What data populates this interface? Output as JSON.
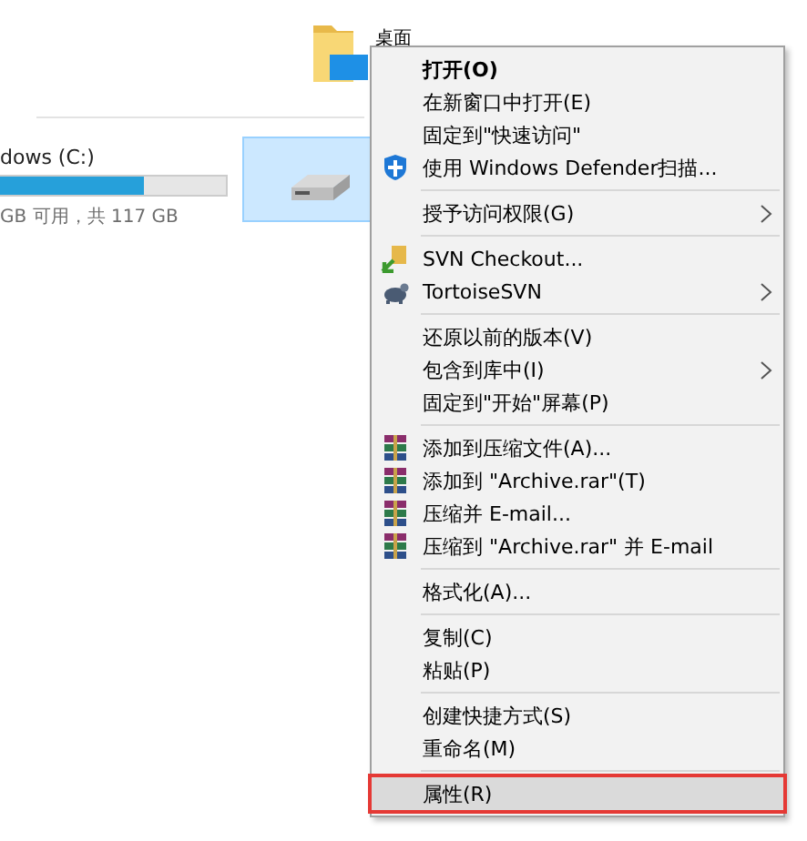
{
  "folder": {
    "label": "桌面"
  },
  "drive": {
    "name": "dows (C:)",
    "level": 0.64,
    "space": "GB 可用，共 117 GB",
    "selected": true
  },
  "menu": {
    "groups": [
      [
        {
          "label": "打开(O)",
          "kind": "plain",
          "default": true,
          "submenu": false,
          "selected": false,
          "callout": false
        },
        {
          "label": "在新窗口中打开(E)",
          "kind": "plain",
          "default": false,
          "submenu": false,
          "selected": false,
          "callout": false
        },
        {
          "label": "固定到\"快速访问\"",
          "kind": "plain",
          "default": false,
          "submenu": false,
          "selected": false,
          "callout": false
        },
        {
          "label": "使用 Windows Defender扫描...",
          "kind": "shield",
          "default": false,
          "submenu": false,
          "selected": false,
          "callout": false
        }
      ],
      [
        {
          "label": "授予访问权限(G)",
          "kind": "plain",
          "default": false,
          "submenu": true,
          "selected": false,
          "callout": false
        }
      ],
      [
        {
          "label": "SVN Checkout...",
          "kind": "checkout",
          "default": false,
          "submenu": false,
          "selected": false,
          "callout": false
        },
        {
          "label": "TortoiseSVN",
          "kind": "tortoise",
          "default": false,
          "submenu": true,
          "selected": false,
          "callout": false
        }
      ],
      [
        {
          "label": "还原以前的版本(V)",
          "kind": "plain",
          "default": false,
          "submenu": false,
          "selected": false,
          "callout": false
        },
        {
          "label": "包含到库中(I)",
          "kind": "plain",
          "default": false,
          "submenu": true,
          "selected": false,
          "callout": false
        },
        {
          "label": "固定到\"开始\"屏幕(P)",
          "kind": "plain",
          "default": false,
          "submenu": false,
          "selected": false,
          "callout": false
        }
      ],
      [
        {
          "label": "添加到压缩文件(A)...",
          "kind": "archive",
          "default": false,
          "submenu": false,
          "selected": false,
          "callout": false
        },
        {
          "label": "添加到 \"Archive.rar\"(T)",
          "kind": "archive",
          "default": false,
          "submenu": false,
          "selected": false,
          "callout": false
        },
        {
          "label": "压缩并 E-mail...",
          "kind": "archive",
          "default": false,
          "submenu": false,
          "selected": false,
          "callout": false
        },
        {
          "label": "压缩到 \"Archive.rar\" 并 E-mail",
          "kind": "archive",
          "default": false,
          "submenu": false,
          "selected": false,
          "callout": false
        }
      ],
      [
        {
          "label": "格式化(A)...",
          "kind": "plain",
          "default": false,
          "submenu": false,
          "selected": false,
          "callout": false
        }
      ],
      [
        {
          "label": "复制(C)",
          "kind": "plain",
          "default": false,
          "submenu": false,
          "selected": false,
          "callout": false
        },
        {
          "label": "粘贴(P)",
          "kind": "plain",
          "default": false,
          "submenu": false,
          "selected": false,
          "callout": false
        }
      ],
      [
        {
          "label": "创建快捷方式(S)",
          "kind": "plain",
          "default": false,
          "submenu": false,
          "selected": false,
          "callout": false
        },
        {
          "label": "重命名(M)",
          "kind": "plain",
          "default": false,
          "submenu": false,
          "selected": false,
          "callout": false
        }
      ],
      [
        {
          "label": "属性(R)",
          "kind": "plain",
          "default": false,
          "submenu": false,
          "selected": true,
          "callout": true
        }
      ]
    ]
  }
}
